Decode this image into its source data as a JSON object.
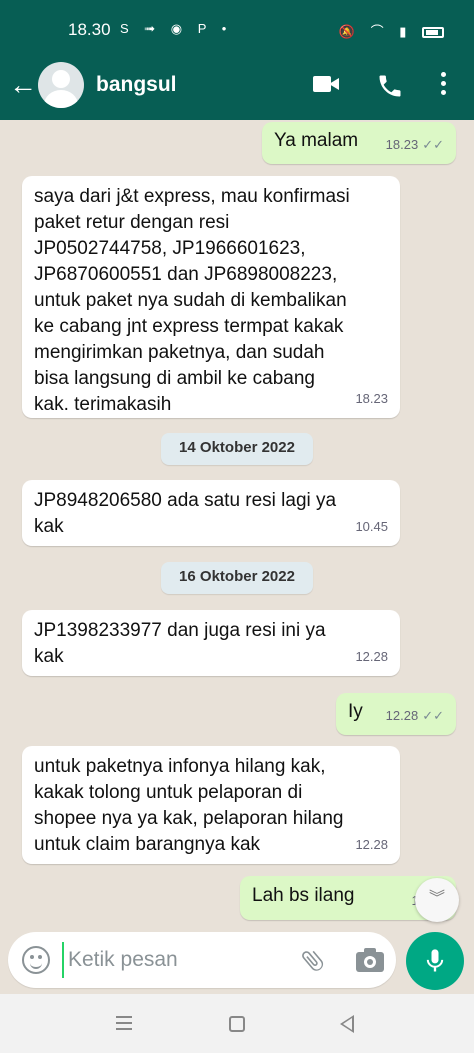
{
  "status_bar": {
    "time": "18.30",
    "left_icons": "S ➟ ◉ P •",
    "right_icons": "🔕 ⌒ ▮"
  },
  "header": {
    "contact_name": "bangsul",
    "back_icon": "back-arrow-icon",
    "video_icon": "video-call-icon",
    "call_icon": "phone-icon",
    "menu_icon": "more-vert-icon"
  },
  "messages": [
    {
      "direction": "out",
      "text": "Ya malam",
      "time": "18.23",
      "read": true
    },
    {
      "direction": "in",
      "text": "saya dari j&t express, mau konfirmasi\npaket retur dengan resi\nJP0502744758, JP1966601623,\nJP6870600551 dan JP6898008223,\nuntuk paket nya sudah di kembalikan\nke cabang jnt express termpat kakak\nmengirimkan paketnya, dan sudah\nbisa langsung di ambil ke cabang\nkak. terimakasih",
      "time": "18.23"
    },
    {
      "direction": "in",
      "text": "JP8948206580 ada satu resi lagi ya\nkak",
      "time": "10.45"
    },
    {
      "direction": "in",
      "text": "JP1398233977 dan juga resi ini ya\nkak",
      "time": "12.28"
    },
    {
      "direction": "out",
      "text": "Iy",
      "time": "12.28",
      "read": true
    },
    {
      "direction": "in",
      "text": "untuk paketnya infonya hilang kak,\nkakak tolong untuk pelaporan di\nshopee nya ya kak, pelaporan hilang\nuntuk claim barangnya kak",
      "time": "12.28"
    },
    {
      "direction": "out",
      "text": "Lah bs ilang",
      "time": "12.29",
      "read": false
    }
  ],
  "date_chips": [
    "14 Oktober 2022",
    "16 Oktober 2022"
  ],
  "ticks_symbol": "✓✓",
  "scroll_down_symbol": "︾",
  "input": {
    "placeholder": "Ketik pesan"
  },
  "colors": {
    "header": "#075e54",
    "outgoing": "#dcf8c6",
    "incoming": "#ffffff",
    "mic": "#00a884",
    "background": "#e8e1d8"
  }
}
